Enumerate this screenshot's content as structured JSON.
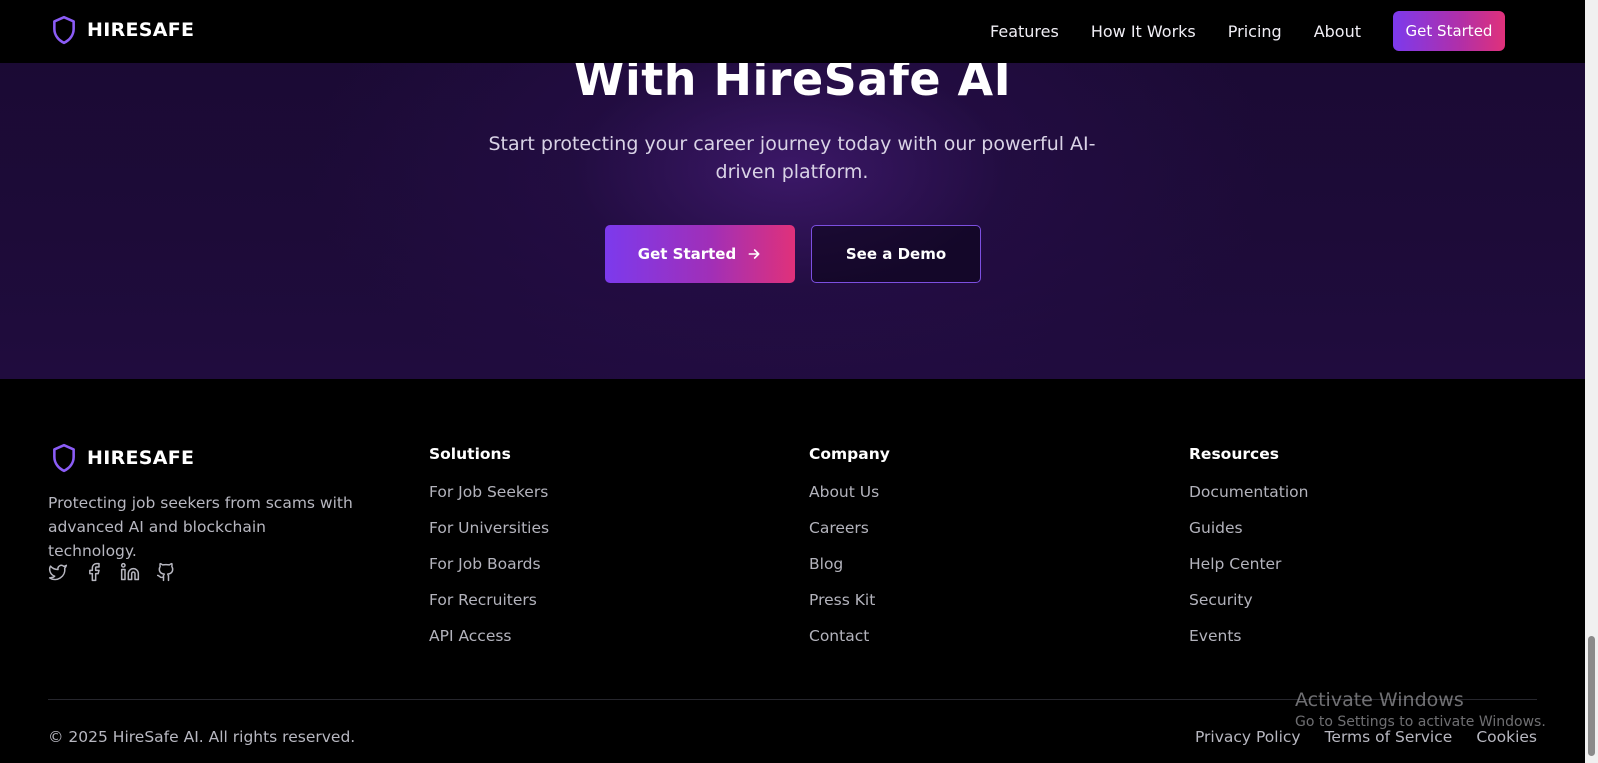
{
  "nav": {
    "brand": "HIRESAFE",
    "links": [
      "Features",
      "How It Works",
      "Pricing",
      "About"
    ],
    "cta": "Get Started"
  },
  "hero": {
    "title": "With HireSafe AI",
    "subtitle": "Start protecting your career journey today with our powerful AI-driven platform.",
    "primary_button": "Get Started",
    "secondary_button": "See a Demo"
  },
  "footer": {
    "brand": "HIRESAFE",
    "description": "Protecting job seekers from scams with advanced AI and blockchain technology.",
    "socials": [
      "twitter-icon",
      "facebook-icon",
      "linkedin-icon",
      "github-icon"
    ],
    "columns": [
      {
        "title": "Solutions",
        "items": [
          "For Job Seekers",
          "For Universities",
          "For Job Boards",
          "For Recruiters",
          "API Access"
        ]
      },
      {
        "title": "Company",
        "items": [
          "About Us",
          "Careers",
          "Blog",
          "Press Kit",
          "Contact"
        ]
      },
      {
        "title": "Resources",
        "items": [
          "Documentation",
          "Guides",
          "Help Center",
          "Security",
          "Events"
        ]
      }
    ],
    "copyright": "© 2025 HireSafe AI. All rights reserved.",
    "legal": [
      "Privacy Policy",
      "Terms of Service",
      "Cookies"
    ]
  },
  "watermark": {
    "title": "Activate Windows",
    "subtitle": "Go to Settings to activate Windows."
  },
  "colors": {
    "accent_start": "#7c3aed",
    "accent_end": "#e0317a",
    "hero_bg": "#1d0b38"
  }
}
